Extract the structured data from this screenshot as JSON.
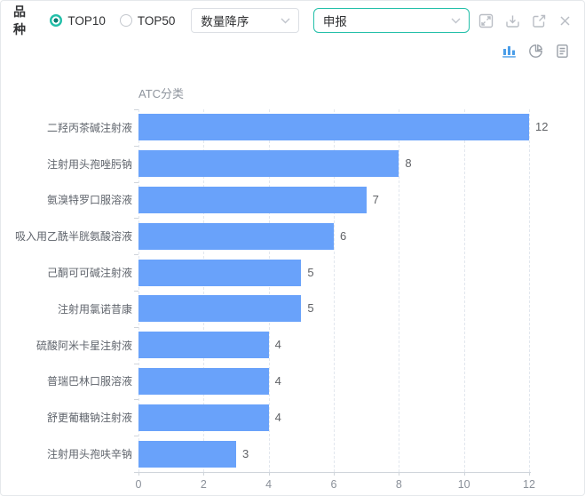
{
  "header": {
    "group_label": "品种",
    "radios": [
      {
        "label": "TOP10",
        "selected": true
      },
      {
        "label": "TOP50",
        "selected": false
      }
    ],
    "sort_select": {
      "value": "数量降序"
    },
    "metric_select": {
      "value": "申报"
    },
    "window_icons": [
      "fullscreen-icon",
      "download-icon",
      "external-link-icon",
      "close-icon"
    ]
  },
  "toolbar": {
    "views": [
      {
        "icon": "bar-chart-icon",
        "active": true
      },
      {
        "icon": "pie-chart-icon",
        "active": false
      },
      {
        "icon": "document-icon",
        "active": false
      }
    ]
  },
  "chart_data": {
    "type": "bar",
    "orientation": "horizontal",
    "title": "ATC分类",
    "categories": [
      "二羟丙茶碱注射液",
      "注射用头孢唑肟钠",
      "氨溴特罗口服溶液",
      "吸入用乙酰半胱氨酸溶液",
      "己酮可可碱注射液",
      "注射用氯诺昔康",
      "硫酸阿米卡星注射液",
      "普瑞巴林口服溶液",
      "舒更葡糖钠注射液",
      "注射用头孢呋辛钠"
    ],
    "values": [
      12,
      8,
      7,
      6,
      5,
      5,
      4,
      4,
      4,
      3
    ],
    "xticks": [
      0,
      2,
      4,
      6,
      8,
      10,
      12
    ],
    "xlim": [
      0,
      12
    ],
    "grid": "dashed-vertical",
    "legend": "none"
  },
  "colors": {
    "accent_teal": "#23bfa9",
    "bar_blue": "#69a2fa",
    "icon_gray": "#b9bdc4",
    "active_view_blue": "#4a9de8",
    "grid_line": "#e2e7ee",
    "axis_line": "#d0d5db"
  }
}
